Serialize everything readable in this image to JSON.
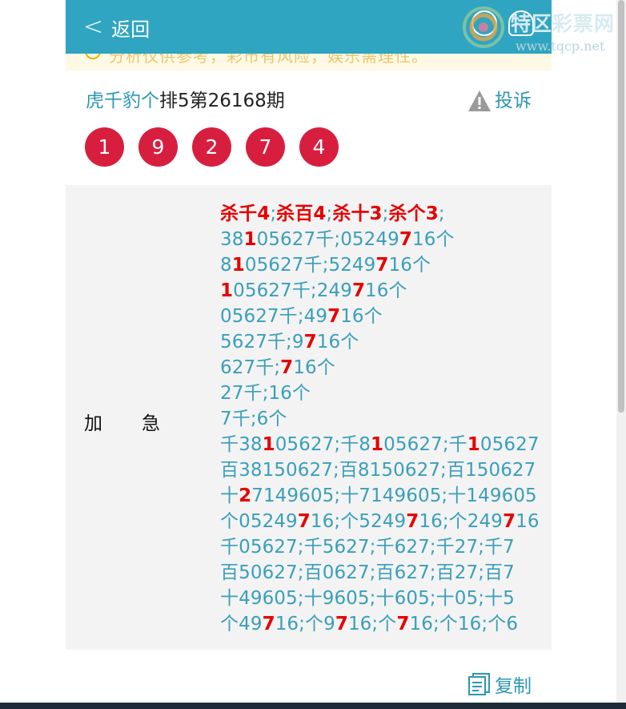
{
  "colors": {
    "header": "#2fa5c1",
    "accent": "#2d97b4",
    "ball": "#d81e3e",
    "highlight": "#e60000"
  },
  "header": {
    "back_label": "返回",
    "icons": [
      "refresh-icon",
      "user-icon"
    ]
  },
  "notice": {
    "text": "分析仅供参考，彩市有风险，娱乐需理性。"
  },
  "watermark": {
    "title": "特区彩票网",
    "url": "www.tqcp.net"
  },
  "title": {
    "author": "虎千豹个",
    "issue": "排5第26168期",
    "complain_label": "投诉"
  },
  "balls": [
    "1",
    "9",
    "2",
    "7",
    "4"
  ],
  "row_label": "加急",
  "content_lines": [
    [
      {
        "t": "杀千4",
        "h": "k"
      },
      {
        "t": ";"
      },
      {
        "t": "杀百4",
        "h": "k"
      },
      {
        "t": ";"
      },
      {
        "t": "杀十3",
        "h": "k"
      },
      {
        "t": ";"
      },
      {
        "t": "杀个3",
        "h": "k"
      },
      {
        "t": ";"
      }
    ],
    [
      {
        "t": "38"
      },
      {
        "t": "1",
        "h": "r"
      },
      {
        "t": "05627千;05249"
      },
      {
        "t": "7",
        "h": "r"
      },
      {
        "t": "16个"
      }
    ],
    [
      {
        "t": "8"
      },
      {
        "t": "1",
        "h": "r"
      },
      {
        "t": "05627千;5249"
      },
      {
        "t": "7",
        "h": "r"
      },
      {
        "t": "16个"
      }
    ],
    [
      {
        "t": "1",
        "h": "r"
      },
      {
        "t": "05627千;249"
      },
      {
        "t": "7",
        "h": "r"
      },
      {
        "t": "16个"
      }
    ],
    [
      {
        "t": "05627千;49"
      },
      {
        "t": "7",
        "h": "r"
      },
      {
        "t": "16个"
      }
    ],
    [
      {
        "t": "5627千;9"
      },
      {
        "t": "7",
        "h": "r"
      },
      {
        "t": "16个"
      }
    ],
    [
      {
        "t": "627千;"
      },
      {
        "t": "7",
        "h": "r"
      },
      {
        "t": "16个"
      }
    ],
    [
      {
        "t": "27千;16个"
      }
    ],
    [
      {
        "t": "7千;6个"
      }
    ],
    [
      {
        "t": "千38"
      },
      {
        "t": "1",
        "h": "r"
      },
      {
        "t": "05627;千8"
      },
      {
        "t": "1",
        "h": "r"
      },
      {
        "t": "05627;千"
      },
      {
        "t": "1",
        "h": "r"
      },
      {
        "t": "05627"
      }
    ],
    [
      {
        "t": "百38150627;百8150627;百150627"
      }
    ],
    [
      {
        "t": "十"
      },
      {
        "t": "2",
        "h": "r"
      },
      {
        "t": "7149605;十7149605;十149605"
      }
    ],
    [
      {
        "t": "个05249"
      },
      {
        "t": "7",
        "h": "r"
      },
      {
        "t": "16;个5249"
      },
      {
        "t": "7",
        "h": "r"
      },
      {
        "t": "16;个249"
      },
      {
        "t": "7",
        "h": "r"
      },
      {
        "t": "16"
      }
    ],
    [
      {
        "t": "千05627;千5627;千627;千27;千7"
      }
    ],
    [
      {
        "t": "百50627;百0627;百627;百27;百7"
      }
    ],
    [
      {
        "t": "十49605;十9605;十605;十05;十5"
      }
    ],
    [
      {
        "t": "个49"
      },
      {
        "t": "7",
        "h": "r"
      },
      {
        "t": "16;个9"
      },
      {
        "t": "7",
        "h": "r"
      },
      {
        "t": "16;个"
      },
      {
        "t": "7",
        "h": "r"
      },
      {
        "t": "16;个16;个6"
      }
    ]
  ],
  "copy_label": "复制"
}
